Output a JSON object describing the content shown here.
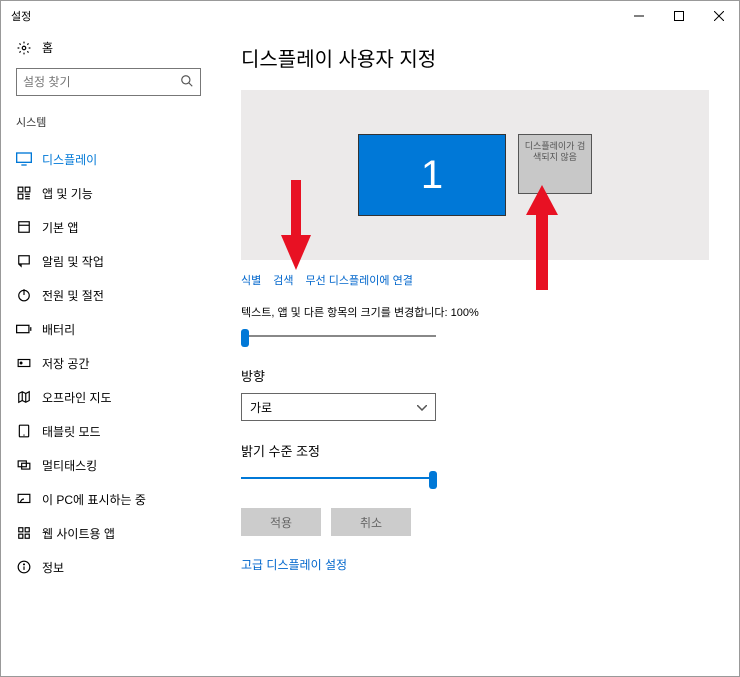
{
  "window": {
    "title": "설정"
  },
  "home": {
    "label": "홈"
  },
  "search": {
    "placeholder": "설정 찾기"
  },
  "category": "시스템",
  "nav": [
    {
      "label": "디스플레이",
      "selected": true
    },
    {
      "label": "앱 및 기능",
      "selected": false
    },
    {
      "label": "기본 앱",
      "selected": false
    },
    {
      "label": "알림 및 작업",
      "selected": false
    },
    {
      "label": "전원 및 절전",
      "selected": false
    },
    {
      "label": "배터리",
      "selected": false
    },
    {
      "label": "저장 공간",
      "selected": false
    },
    {
      "label": "오프라인 지도",
      "selected": false
    },
    {
      "label": "태블릿 모드",
      "selected": false
    },
    {
      "label": "멀티태스킹",
      "selected": false
    },
    {
      "label": "이 PC에 표시하는 중",
      "selected": false
    },
    {
      "label": "웹 사이트용 앱",
      "selected": false
    },
    {
      "label": "정보",
      "selected": false
    }
  ],
  "page": {
    "title": "디스플레이 사용자 지정"
  },
  "displays": {
    "primary": "1",
    "secondary": "디스플레이가 검색되지 않음"
  },
  "links": {
    "identify": "식별",
    "detect": "검색",
    "connect": "무선 디스플레이에 연결"
  },
  "scaling": {
    "label": "텍스트, 앱 및 다른 항목의 크기를 변경합니다: 100%"
  },
  "orientation": {
    "heading": "방향",
    "value": "가로"
  },
  "brightness": {
    "heading": "밝기 수준 조정"
  },
  "buttons": {
    "apply": "적용",
    "cancel": "취소"
  },
  "advanced": "고급 디스플레이 설정"
}
